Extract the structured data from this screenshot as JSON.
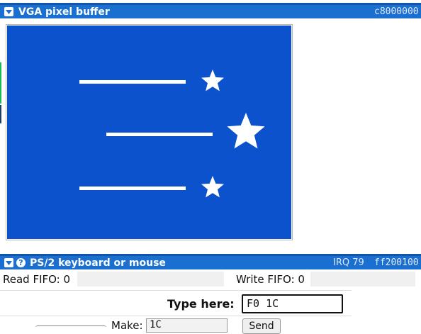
{
  "vga_panel": {
    "title": "VGA pixel buffer",
    "address": "c8000000",
    "collapse_icon": "chevron-down-icon",
    "screen": {
      "background_color": "#0b52cc",
      "foreground_color": "#ffffff",
      "content": "three horizontal lines each followed by a white star"
    }
  },
  "ps2_panel": {
    "title": "PS/2 keyboard or mouse",
    "collapse_icon": "chevron-down-icon",
    "help_icon": "help-icon",
    "irq": "IRQ 79",
    "address": "ff200100",
    "read_fifo_label": "Read FIFO: 0",
    "write_fifo_label": "Write FIFO: 0",
    "type_here_label": "Type here:",
    "type_here_value": "F0 1C",
    "make_label": "Make:",
    "make_value": "1C",
    "send_label": "Send"
  },
  "colors": {
    "header_blue": "#1a6fd1",
    "side_accent_green": "#1db954",
    "side_accent_dark": "#1f3f66"
  }
}
